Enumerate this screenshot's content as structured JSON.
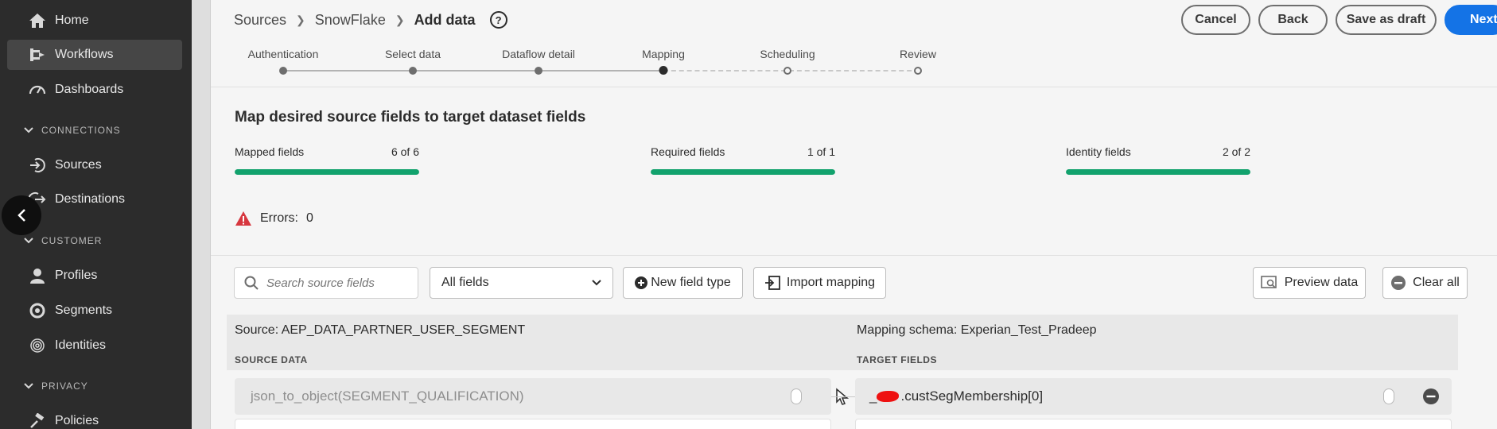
{
  "nav": {
    "items": [
      {
        "label": "Home",
        "icon": "home-icon"
      },
      {
        "label": "Workflows",
        "icon": "workflow-icon"
      },
      {
        "label": "Dashboards",
        "icon": "dashboard-icon"
      },
      {
        "label": "Sources",
        "icon": "sources-icon"
      },
      {
        "label": "Destinations",
        "icon": "destinations-icon"
      },
      {
        "label": "Profiles",
        "icon": "profile-icon"
      },
      {
        "label": "Segments",
        "icon": "segments-icon"
      },
      {
        "label": "Identities",
        "icon": "fingerprint-icon"
      },
      {
        "label": "Policies",
        "icon": "gavel-icon"
      }
    ],
    "sections": [
      "CONNECTIONS",
      "CUSTOMER",
      "PRIVACY"
    ]
  },
  "breadcrumb": {
    "root": "Sources",
    "connector": "SnowFlake",
    "current": "Add data",
    "help": "?"
  },
  "actions": {
    "cancel": "Cancel",
    "back": "Back",
    "save_draft": "Save as draft",
    "next": "Next"
  },
  "stepper": {
    "steps": [
      "Authentication",
      "Select data",
      "Dataflow detail",
      "Mapping",
      "Scheduling",
      "Review"
    ],
    "current_step": "Mapping"
  },
  "summary": {
    "title": "Map desired source fields to target dataset fields",
    "mapped_label": "Mapped fields",
    "mapped_value": "6 of 6",
    "mapped_progress": 1.0,
    "required_label": "Required fields",
    "required_value": "1 of 1",
    "required_progress": 1.0,
    "identity_label": "Identity fields",
    "identity_value": "2 of 2",
    "identity_progress": 1.0,
    "errors_label": "Errors:",
    "errors_value": "0"
  },
  "toolbar": {
    "search_placeholder": "Search source fields",
    "filter_value": "All fields",
    "new_field_type": "New field type",
    "import_mapping": "Import mapping",
    "preview_data": "Preview data",
    "clear_all": "Clear all"
  },
  "mapping": {
    "source_title": "Source: AEP_DATA_PARTNER_USER_SEGMENT",
    "target_title": "Mapping schema: Experian_Test_Pradeep",
    "source_caption": "SOURCE DATA",
    "target_caption": "TARGET FIELDS",
    "rows": [
      {
        "source": "json_to_object(SEGMENT_QUALIFICATION)",
        "target_prefix": "_",
        "target": ".custSegMembership[0]"
      }
    ]
  },
  "colors": {
    "accent": "#1473e6",
    "progress": "#12a26d",
    "error": "#d7373f",
    "nav_bg": "#2c2c2c"
  }
}
